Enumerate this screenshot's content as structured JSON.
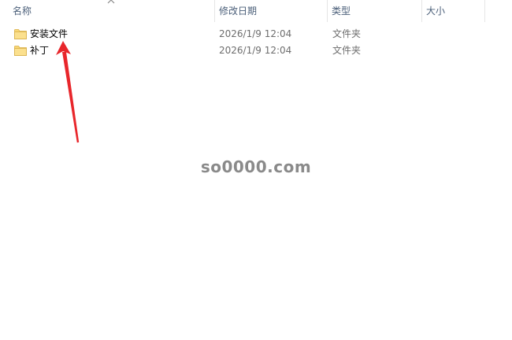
{
  "columns": {
    "name": "名称",
    "modified": "修改日期",
    "type": "类型",
    "size": "大小"
  },
  "sort": {
    "column": "name",
    "direction": "up-icon"
  },
  "files": [
    {
      "name": "安装文件",
      "modified": "2026/1/9 12:04",
      "type": "文件夹",
      "icon": "folder-icon"
    },
    {
      "name": "补丁",
      "modified": "2026/1/9 12:04",
      "type": "文件夹",
      "icon": "folder-icon"
    }
  ],
  "watermark": "so0000.com",
  "colors": {
    "header_text": "#4c607a",
    "folder_fill": "#f8d775",
    "arrow": "#e8262b",
    "watermark": "#8a8a8a"
  }
}
